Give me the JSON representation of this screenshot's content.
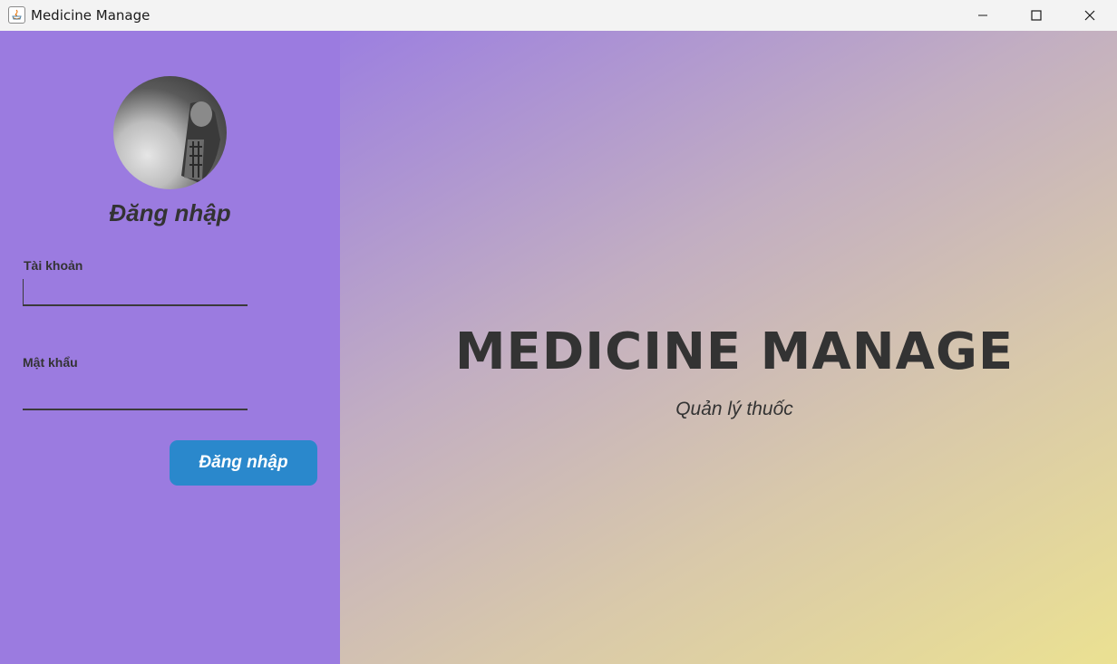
{
  "window": {
    "title": "Medicine Manage",
    "icon": "java-app-icon",
    "controls": [
      "minimize-icon",
      "maximize-icon",
      "close-icon"
    ]
  },
  "login": {
    "title": "Đăng nhập",
    "username_label": "Tài khoản",
    "username_value": "",
    "password_label": "Mật khẩu",
    "password_value": "",
    "button_label": "Đăng nhập"
  },
  "brand": {
    "title": "MEDICINE MANAGE",
    "subtitle": "Quản lý thuốc"
  },
  "colors": {
    "left_panel": "#9b7be0",
    "button": "#2a88cc",
    "text": "#333333",
    "gradient_start": "#9c7fe0",
    "gradient_end": "#ebe192"
  }
}
